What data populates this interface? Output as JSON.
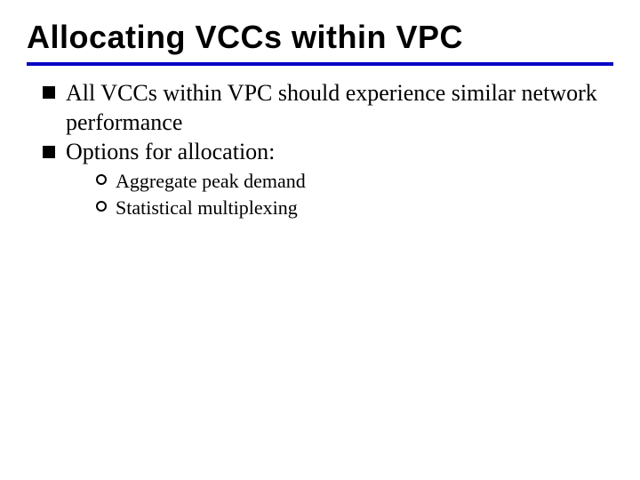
{
  "title": "Allocating VCCs within VPC",
  "bullets": [
    {
      "text": "All VCCs within VPC should experience similar network performance"
    },
    {
      "text": "Options for allocation:"
    }
  ],
  "subbullets": [
    {
      "text": "Aggregate peak demand"
    },
    {
      "text": "Statistical multiplexing"
    }
  ]
}
